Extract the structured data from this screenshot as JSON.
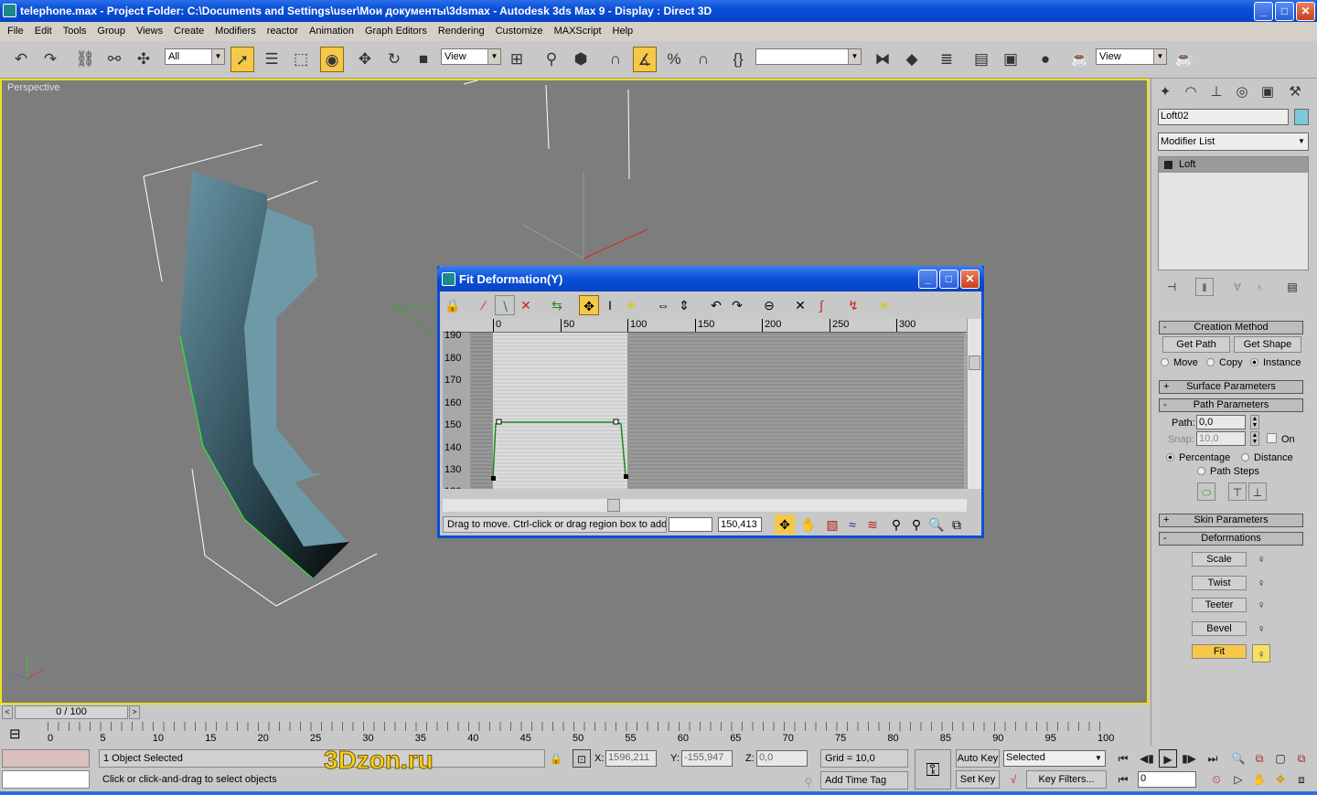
{
  "window": {
    "title": "telephone.max    - Project Folder: C:\\Documents and Settings\\user\\Мои документы\\3dsmax    - Autodesk 3ds Max 9    - Display : Direct 3D",
    "minimize": "_",
    "maximize": "□",
    "close": "✕"
  },
  "menu": [
    "File",
    "Edit",
    "Tools",
    "Group",
    "Views",
    "Create",
    "Modifiers",
    "reactor",
    "Animation",
    "Graph Editors",
    "Rendering",
    "Customize",
    "MAXScript",
    "Help"
  ],
  "toolbar": {
    "selection_filter": "All",
    "ref_coord": "View",
    "named_selection": "",
    "render_view": "View"
  },
  "viewport": {
    "label": "Perspective",
    "accent": "#f0e020"
  },
  "command_panel": {
    "object_name": "Loft02",
    "object_color": "#7ec8d8",
    "modifier_list": "Modifier List",
    "stack": [
      "Loft"
    ],
    "creation_method": {
      "title": "Creation Method",
      "get_path": "Get Path",
      "get_shape": "Get Shape",
      "options": [
        "Move",
        "Copy",
        "Instance"
      ],
      "selected": "Instance"
    },
    "surface_parameters": "Surface Parameters",
    "path_parameters": {
      "title": "Path Parameters",
      "path_label": "Path:",
      "path_value": "0,0",
      "snap_label": "Snap:",
      "snap_value": "10,0",
      "on_label": "On",
      "modes": [
        "Percentage",
        "Distance",
        "Path Steps"
      ],
      "selected": "Percentage"
    },
    "skin_parameters": "Skin Parameters",
    "deformations": {
      "title": "Deformations",
      "items": [
        "Scale",
        "Twist",
        "Teeter",
        "Bevel",
        "Fit"
      ],
      "active": "Fit"
    }
  },
  "dialog": {
    "title": "Fit Deformation(Y)",
    "ruler": [
      "0",
      "50",
      "100",
      "150",
      "200",
      "250",
      "300"
    ],
    "y_labels": [
      "190",
      "180",
      "170",
      "160",
      "150",
      "140",
      "130",
      "120"
    ],
    "status": "Drag to move. Ctrl-click or drag region box to add i",
    "field1": "",
    "field2": "150,413"
  },
  "timeline": {
    "frame": "0 / 100",
    "ticks": [
      "0",
      "5",
      "10",
      "15",
      "20",
      "25",
      "30",
      "35",
      "40",
      "45",
      "50",
      "55",
      "60",
      "65",
      "70",
      "75",
      "80",
      "85",
      "90",
      "95",
      "100"
    ]
  },
  "status": {
    "selected": "1 Object Selected",
    "prompt": "Click or click-and-drag to select objects",
    "x_label": "X:",
    "x": "1596,211",
    "y_label": "Y:",
    "y": "-155,947",
    "z_label": "Z:",
    "z": "0,0",
    "grid": "Grid = 10,0",
    "add_time_tag": "Add Time Tag",
    "auto_key": "Auto Key",
    "set_key": "Set Key",
    "key_mode": "Selected",
    "key_filters": "Key Filters...",
    "current_frame": "0",
    "watermark": "3Dzon.ru"
  }
}
